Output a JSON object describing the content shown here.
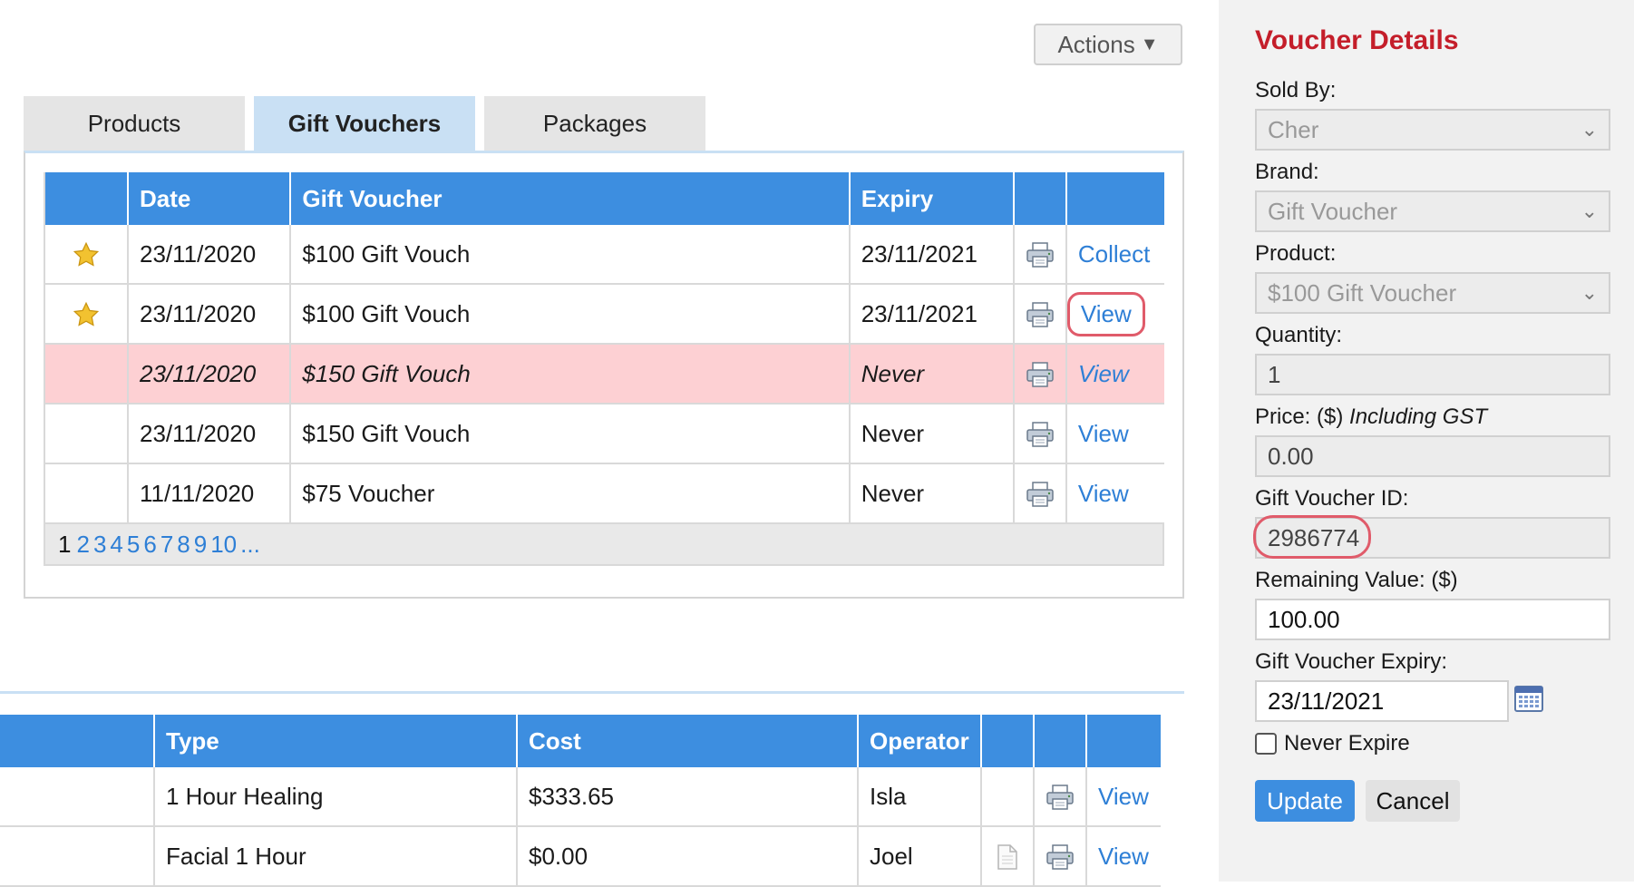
{
  "actions": {
    "label": "Actions",
    "caret": "▼"
  },
  "tabs": [
    {
      "label": "Products",
      "active": false
    },
    {
      "label": "Gift Vouchers",
      "active": true
    },
    {
      "label": "Packages",
      "active": false
    }
  ],
  "vouchers": {
    "columns": [
      "",
      "Date",
      "Gift Voucher",
      "Expiry",
      "",
      ""
    ],
    "rows": [
      {
        "starred": true,
        "date": "23/11/2020",
        "voucher": "$100 Gift Vouch",
        "expiry": "23/11/2021",
        "action": "Collect",
        "highlight": false
      },
      {
        "starred": true,
        "date": "23/11/2020",
        "voucher": "$100 Gift Vouch",
        "expiry": "23/11/2021",
        "action": "View",
        "highlight": false
      },
      {
        "starred": false,
        "date": "23/11/2020",
        "voucher": "$150 Gift Vouch",
        "expiry": "Never",
        "action": "View",
        "highlight": true
      },
      {
        "starred": false,
        "date": "23/11/2020",
        "voucher": "$150 Gift Vouch",
        "expiry": "Never",
        "action": "View",
        "highlight": false
      },
      {
        "starred": false,
        "date": "11/11/2020",
        "voucher": "$75 Voucher",
        "expiry": "Never",
        "action": "View",
        "highlight": false
      }
    ]
  },
  "pager": {
    "current": "1",
    "pages": [
      "2",
      "3",
      "4",
      "5",
      "6",
      "7",
      "8",
      "9",
      "10",
      "..."
    ]
  },
  "services": {
    "columns": [
      "",
      "Type",
      "Cost",
      "Operator",
      "",
      "",
      ""
    ],
    "rows": [
      {
        "type": "1 Hour Healing",
        "cost": "$333.65",
        "operator": "Isla",
        "has_doc": false,
        "action": "View"
      },
      {
        "type": "Facial 1 Hour",
        "cost": "$0.00",
        "operator": "Joel",
        "has_doc": true,
        "action": "View"
      }
    ]
  },
  "details": {
    "title": "Voucher Details",
    "sold_by_label": "Sold By:",
    "sold_by_value": "Cher",
    "brand_label": "Brand:",
    "brand_value": "Gift Voucher",
    "product_label": "Product:",
    "product_value": "$100 Gift Voucher",
    "quantity_label": "Quantity:",
    "quantity_value": "1",
    "price_label": "Price: ($)",
    "price_note": "Including GST",
    "price_value": "0.00",
    "id_label": "Gift Voucher ID:",
    "id_value": "2986774",
    "remaining_label": "Remaining Value: ($)",
    "remaining_value": "100.00",
    "expiry_label": "Gift Voucher Expiry:",
    "expiry_value": "23/11/2021",
    "never_expire_label": "Never Expire",
    "update_label": "Update",
    "cancel_label": "Cancel"
  },
  "colors": {
    "header_blue": "#3d8ee0",
    "tab_active": "#c9e0f4",
    "highlight_row": "#fdd0d3",
    "title_red": "#c41e2a",
    "link": "#2e7fd6",
    "annotation": "#e05b6a"
  }
}
